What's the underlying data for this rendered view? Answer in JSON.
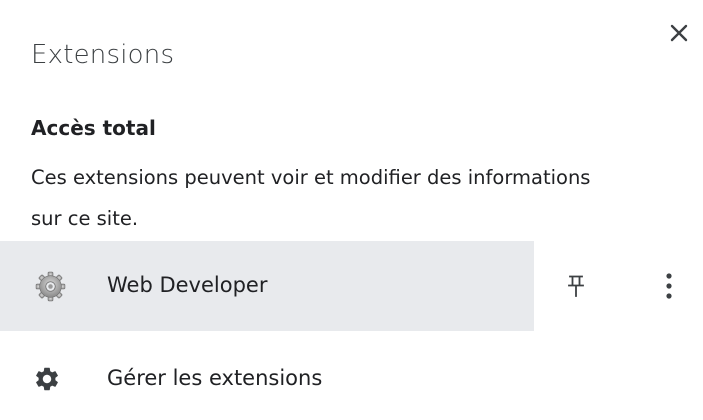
{
  "panel": {
    "title": "Extensions",
    "close_icon": "close-icon"
  },
  "section": {
    "heading": "Accès total",
    "description": "Ces extensions peuvent voir et modifier des informations sur ce site."
  },
  "extensions": [
    {
      "name": "Web Developer",
      "icon": "gear-extension-icon",
      "pin_icon": "pin-icon",
      "menu_icon": "more-vert-icon"
    }
  ],
  "manage": {
    "label": "Gérer les extensions",
    "icon": "settings-gear-icon"
  },
  "colors": {
    "hover_row": "#e8eaed",
    "text": "#202124",
    "icon": "#5f6368"
  }
}
